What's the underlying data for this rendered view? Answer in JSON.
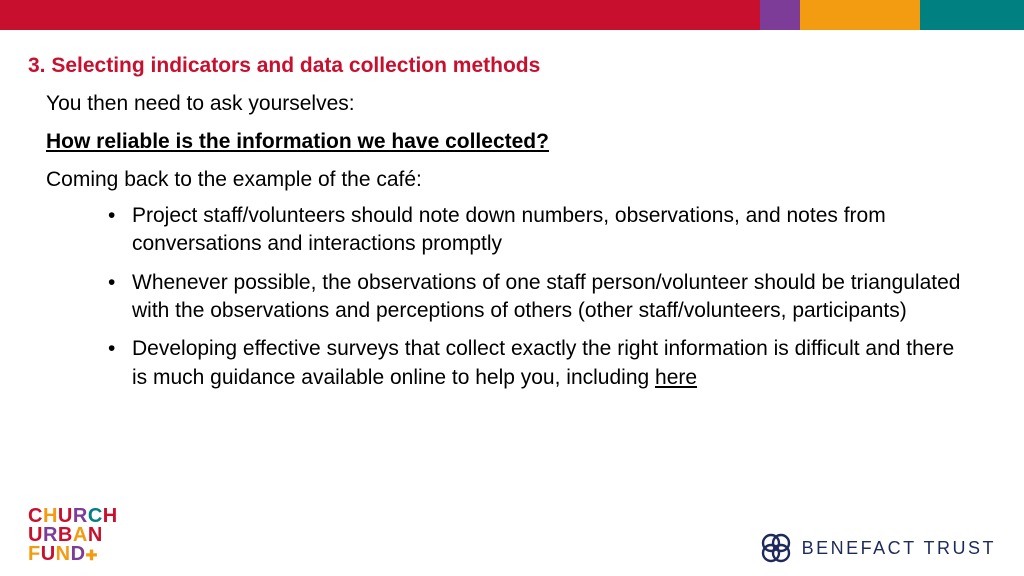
{
  "header_band": {
    "colors": [
      "#c8102e",
      "#7d3c98",
      "#f39c12",
      "#008080"
    ]
  },
  "slide": {
    "heading": "3. Selecting indicators and data collection methods",
    "intro": "You then need to ask yourselves:",
    "question": "How reliable is the information we have collected?",
    "example_lead": "Coming back to the example of the café:",
    "bullets": [
      "Project staff/volunteers should note down numbers, observations, and notes from conversations and interactions promptly",
      "Whenever possible, the observations of one staff person/volunteer should be triangulated with the observations and perceptions of others (other staff/volunteers, participants)",
      "Developing effective surveys that collect exactly the right information is difficult and there is much guidance available online to help you, including "
    ],
    "bullet3_link_text": "here"
  },
  "footer": {
    "left_logo": {
      "line1": "CHURCH",
      "line2": "URBAN",
      "line3": "FUND"
    },
    "right_logo": {
      "name": "BENEFACT TRUST"
    }
  }
}
